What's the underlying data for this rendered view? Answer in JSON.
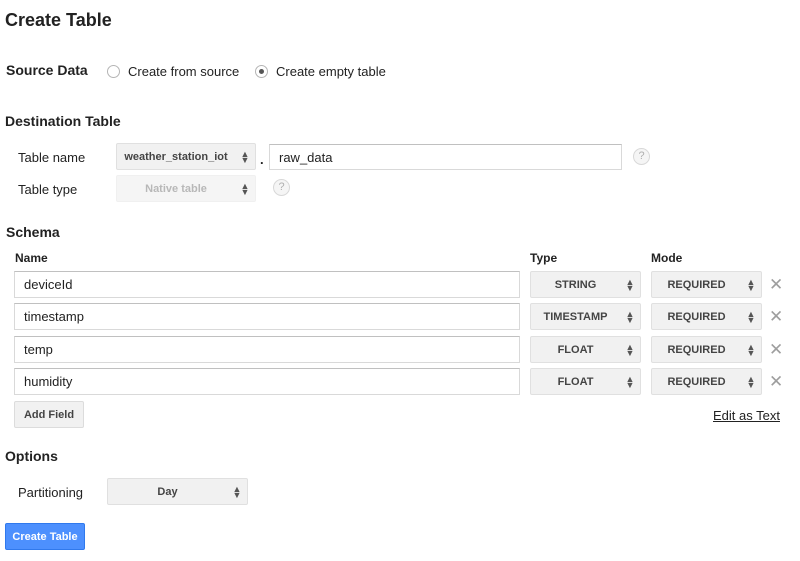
{
  "page_title": "Create Table",
  "source_data": {
    "label": "Source Data",
    "options": [
      {
        "label": "Create from source",
        "checked": false
      },
      {
        "label": "Create empty table",
        "checked": true
      }
    ]
  },
  "destination": {
    "heading": "Destination Table",
    "table_name_label": "Table name",
    "dataset": "weather_station_iot",
    "separator": ".",
    "table_name_value": "raw_data",
    "table_type_label": "Table type",
    "table_type": "Native table",
    "help_glyph": "?"
  },
  "schema": {
    "heading": "Schema",
    "columns": {
      "name": "Name",
      "type": "Type",
      "mode": "Mode"
    },
    "fields": [
      {
        "name": "deviceId",
        "type": "STRING",
        "mode": "REQUIRED"
      },
      {
        "name": "timestamp",
        "type": "TIMESTAMP",
        "mode": "REQUIRED"
      },
      {
        "name": "temp",
        "type": "FLOAT",
        "mode": "REQUIRED"
      },
      {
        "name": "humidity",
        "type": "FLOAT",
        "mode": "REQUIRED"
      }
    ],
    "add_field_label": "Add Field",
    "edit_as_text_label": "Edit as Text",
    "remove_glyph": "✕"
  },
  "options": {
    "heading": "Options",
    "partitioning_label": "Partitioning",
    "partitioning_value": "Day"
  },
  "submit_label": "Create Table",
  "colors": {
    "primary_button": "#4d90fe",
    "select_bg": "#f1f1f1"
  }
}
